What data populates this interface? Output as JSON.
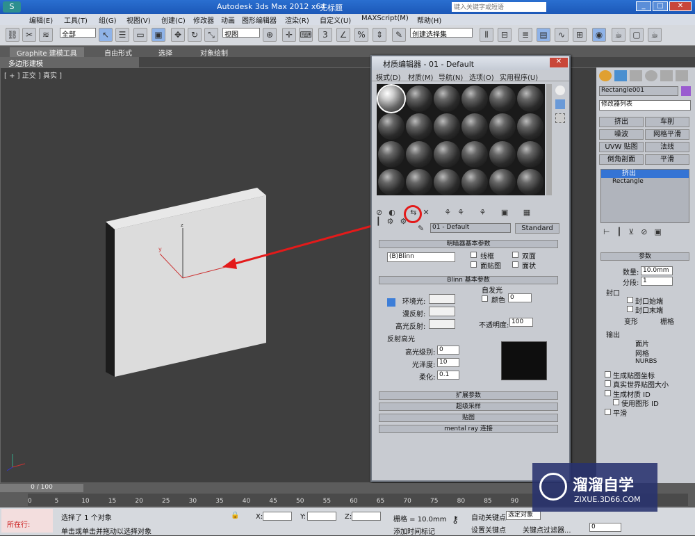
{
  "app": {
    "title": "Autodesk 3ds Max  2012 x64",
    "file": "无标题",
    "search_placeholder": "键入关键字或短语"
  },
  "menu": [
    "编辑(E)",
    "工具(T)",
    "组(G)",
    "视图(V)",
    "创建(C)",
    "修改器",
    "动画",
    "图形编辑器",
    "渲染(R)",
    "自定义(U)",
    "MAXScript(M)",
    "帮助(H)"
  ],
  "toolbar": {
    "selection_filter": "全部",
    "ref_coord": "视图",
    "named_set": "创建选择集"
  },
  "ribbon": {
    "tabs": [
      "Graphite 建模工具",
      "自由形式",
      "选择",
      "对象绘制"
    ],
    "sub": "多边形建模"
  },
  "viewport": {
    "label": "[ + ] 正交 ] 真实 ]"
  },
  "material_editor": {
    "title": "材质编辑器 - 01 - Default",
    "menu": [
      "模式(D)",
      "材质(M)",
      "导航(N)",
      "选项(O)",
      "实用程序(U)"
    ],
    "material_name": "01 - Default",
    "material_type": "Standard",
    "shader_rollout": "明暗器基本参数",
    "shader": "(B)Blinn",
    "shader_opts": [
      "线框",
      "双面",
      "面贴图",
      "面状"
    ],
    "blinn_rollout": "Blinn 基本参数",
    "self_illum": "自发光",
    "color_label": "颜色",
    "self_illum_value": "0",
    "ambient": "环境光:",
    "diffuse": "漫反射:",
    "specular": "高光反射:",
    "opacity_label": "不透明度:",
    "opacity_value": "100",
    "spec_group": "反射高光",
    "spec_level": "高光级别:",
    "spec_level_value": "0",
    "gloss": "光泽度:",
    "gloss_value": "10",
    "soften": "柔化:",
    "soften_value": "0.1",
    "rollouts": [
      "扩展参数",
      "超级采样",
      "贴图",
      "mental ray 连接"
    ]
  },
  "panel": {
    "object_name": "Rectangle001",
    "modifier_list": "修改器列表",
    "mod_buttons": [
      "挤出",
      "车削",
      "噪波",
      "网格平滑",
      "UVW 贴图",
      "法线",
      "倒角剖面",
      "平滑"
    ],
    "stack": [
      "挤出",
      "Rectangle"
    ],
    "params_title": "参数",
    "amount_label": "数量:",
    "amount": "10.0mm",
    "segments_label": "分段:",
    "segments": "1",
    "cap_group": "封口",
    "cap_start": "封口始端",
    "cap_end": "封口末端",
    "morph": "变形",
    "grid": "栅格",
    "output_group": "输出",
    "out_patch": "面片",
    "out_mesh": "网格",
    "out_nurbs": "NURBS",
    "gen_map": "生成贴图坐标",
    "real_world": "真实世界贴图大小",
    "gen_mat": "生成材质 ID",
    "use_shape": "使用图形 ID",
    "smooth": "平滑"
  },
  "timeline": {
    "frame": "0 / 100",
    "ticks": [
      "0",
      "5",
      "10",
      "15",
      "20",
      "25",
      "30",
      "35",
      "40",
      "45",
      "50",
      "55",
      "60",
      "65",
      "70",
      "75",
      "80",
      "85",
      "90"
    ]
  },
  "status": {
    "selected": "选择了 1 个对象",
    "hint": "单击或单击并拖动以选择对象",
    "current": "所在行:",
    "x": "X:",
    "y": "Y:",
    "z": "Z:",
    "grid": "栅格 = 10.0mm",
    "add_time": "添加时间标记",
    "auto_key": "自动关键点",
    "set_key": "设置关键点",
    "selected_obj": "选定对象",
    "key_filter": "关键点过滤器...",
    "frame": "0"
  },
  "watermark": {
    "name": "溜溜自学",
    "url": "ZIXUE.3D66.COM"
  }
}
